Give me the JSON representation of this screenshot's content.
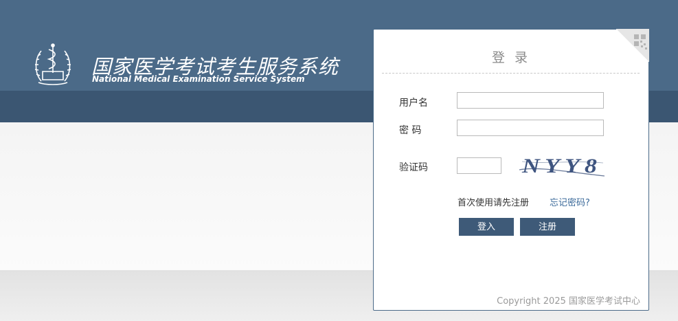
{
  "header": {
    "title": "国家医学考试考生服务系统",
    "subtitle": "National Medical Examination Service System",
    "logo_icon": "caduceus-emblem-icon"
  },
  "login": {
    "title": "登 录",
    "username_label": "用户名",
    "password_label": "密 码",
    "captcha_label": "验证码",
    "captcha_text": "NYY8",
    "username_value": "",
    "password_value": "",
    "captcha_value": "",
    "register_hint": "首次使用请先注册",
    "forgot_password": "忘记密码?",
    "login_button": "登入",
    "register_button": "注册",
    "qr_icon": "qr-code-icon"
  },
  "footer": {
    "copyright": "Copyright 2025 国家医学考试中心"
  },
  "colors": {
    "header": "#4b6a88",
    "header_band": "#3b5672",
    "button": "#3e5a78",
    "link": "#3b6a9a"
  }
}
